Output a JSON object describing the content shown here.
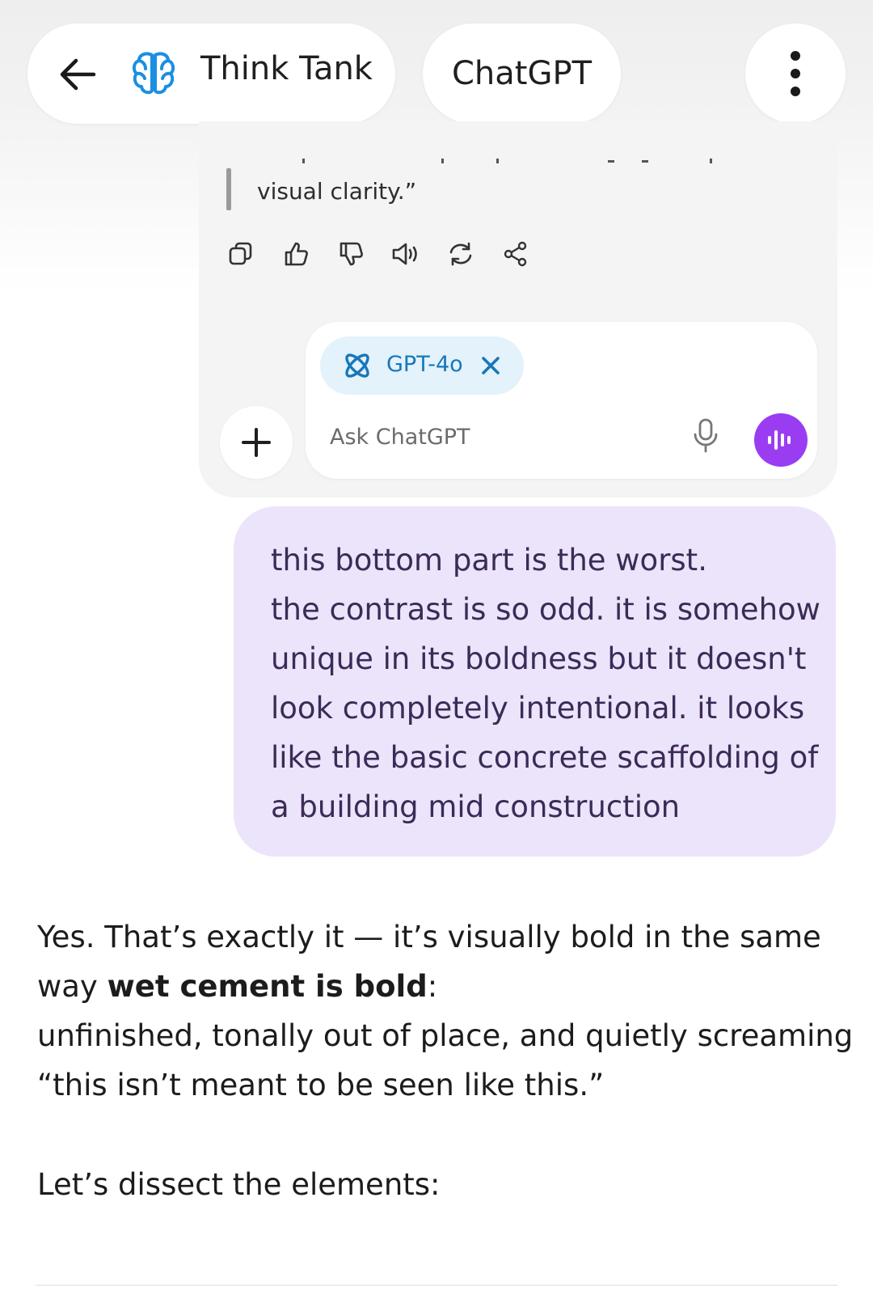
{
  "header": {
    "title": "Think Tank",
    "model": "ChatGPT",
    "back_icon": "arrow-left-icon",
    "app_icon": "brain-icon",
    "menu_icon": "kebab-menu-icon"
  },
  "previous_response": {
    "quote_tail": "visual clarity.”",
    "actions": [
      "copy-icon",
      "thumbs-up-icon",
      "thumbs-down-icon",
      "speaker-icon",
      "regenerate-icon",
      "share-icon"
    ]
  },
  "composer": {
    "model_chip": "GPT-4o",
    "placeholder": "Ask ChatGPT",
    "accent": "#9a3df2",
    "chip_color": "#1877b8"
  },
  "user_message": {
    "lines": [
      "this bottom part is the worst.",
      "the contrast is so odd. it is somehow",
      "unique in its boldness but it doesn't",
      "look completely intentional. it looks",
      "like the basic concrete scaffolding of",
      "a building mid construction"
    ],
    "bubble_color": "#ece4fa"
  },
  "assistant_reply": {
    "line1": "Yes. That’s exactly it — it’s visually bold in the same",
    "line2_prefix": "way ",
    "line2_bold": "wet cement is bold",
    "line2_suffix": ":",
    "line3": "unfinished, tonally out of place, and quietly screaming",
    "line4": "“this isn’t meant to be seen like this.”",
    "paragraph2": "Let’s dissect the elements:"
  }
}
